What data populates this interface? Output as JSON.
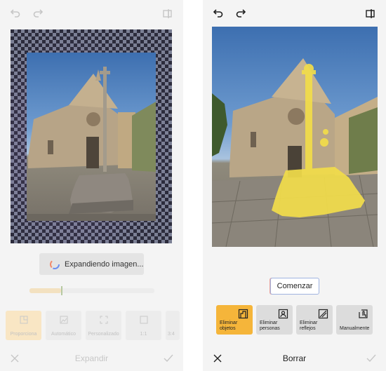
{
  "left_panel": {
    "status_pill": "Expandiendo imagen...",
    "slider_value": 0.25,
    "options": [
      {
        "label": "Proporciona",
        "icon": "aspect-icon",
        "selected": true
      },
      {
        "label": "Automático",
        "icon": "image-icon",
        "selected": false
      },
      {
        "label": "Personalizado",
        "icon": "crop-corners-icon",
        "selected": false
      },
      {
        "label": "1:1",
        "icon": "square-icon",
        "selected": false
      },
      {
        "label": "3:4",
        "icon": "portrait-icon",
        "selected": false
      }
    ],
    "bottom_title": "Expandir"
  },
  "right_panel": {
    "start_button": "Comenzar",
    "tools": [
      {
        "label": "Eliminar objetos",
        "icon": "object-remove-icon",
        "selected": true
      },
      {
        "label": "Eliminar personas",
        "icon": "person-remove-icon",
        "selected": false
      },
      {
        "label": "Eliminar reflejos",
        "icon": "reflection-icon",
        "selected": false
      },
      {
        "label": "Manualmente",
        "icon": "hand-brush-icon",
        "selected": false
      }
    ],
    "bottom_title": "Borrar"
  },
  "colors": {
    "accent": "#f5b53a",
    "highlight_overlay": "#f2dd4a",
    "selected_option": "#f9e6c4"
  }
}
